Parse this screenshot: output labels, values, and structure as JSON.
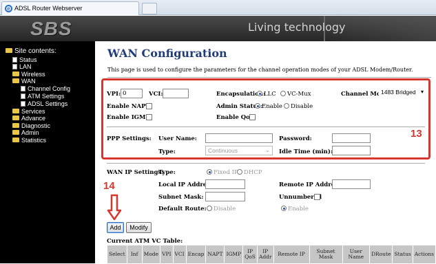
{
  "browser": {
    "tab_title": "ADSL Router Webserver"
  },
  "header": {
    "logo": "SBS",
    "tagline": "Living technology"
  },
  "sidebar": {
    "heading": "Site contents:",
    "items": [
      {
        "label": "Status"
      },
      {
        "label": "LAN"
      },
      {
        "label": "Wireless"
      },
      {
        "label": "WAN"
      },
      {
        "label": "Channel Config"
      },
      {
        "label": "ATM Settings"
      },
      {
        "label": "ADSL Settings"
      },
      {
        "label": "Services"
      },
      {
        "label": "Advance"
      },
      {
        "label": "Diagnostic"
      },
      {
        "label": "Admin"
      },
      {
        "label": "Statistics"
      }
    ]
  },
  "page": {
    "title": "WAN Configuration",
    "description": "This page is used to configure the parameters for the channel operation modes of your ADSL Modem/Router."
  },
  "form": {
    "vpi_label": "VPI:",
    "vpi_value": "0",
    "vci_label": "VCI:",
    "vci_value": "",
    "encap_label": "Encapsulation:",
    "encap_opt1": "LLC",
    "encap_opt2": "VC-Mux",
    "channel_mode_label": "Channel Mode:",
    "channel_mode_value": "1483 Bridged",
    "napt_label": "Enable NAPT:",
    "admin_label": "Admin Status:",
    "admin_opt1": "Enable",
    "admin_opt2": "Disable",
    "igmp_label": "Enable IGMP:",
    "qos_label": "Enable QoS:",
    "ppp_label": "PPP Settings:",
    "username_label": "User Name:",
    "password_label": "Password:",
    "type_label": "Type:",
    "type_value": "Continuous",
    "idle_label": "Idle Time (min):",
    "wanip_label": "WAN IP Settings:",
    "wanip_type_label": "Type:",
    "fixed_ip": "Fixed IP",
    "dhcp": "DHCP",
    "local_ip_label": "Local IP Address:",
    "remote_ip_label": "Remote IP Address:",
    "subnet_label": "Subnet Mask:",
    "unnumbered_label": "Unnumbered",
    "default_route_label": "Default Route:",
    "dr_disable": "Disable",
    "dr_enable": "Enable"
  },
  "annotations": {
    "box_number": "13",
    "button_number": "14",
    "accent_color": "#d7352d"
  },
  "buttons": {
    "add": "Add",
    "modify": "Modify"
  },
  "table": {
    "title": "Current ATM VC Table:",
    "columns": [
      "Select",
      "Inf",
      "Mode",
      "VPI",
      "VCI",
      "Encap",
      "NAPT",
      "IGMP",
      "IP QoS",
      "IP Addr",
      "Remote IP",
      "Subnet Mask",
      "User Name",
      "DRoute",
      "Status",
      "Actions"
    ]
  }
}
